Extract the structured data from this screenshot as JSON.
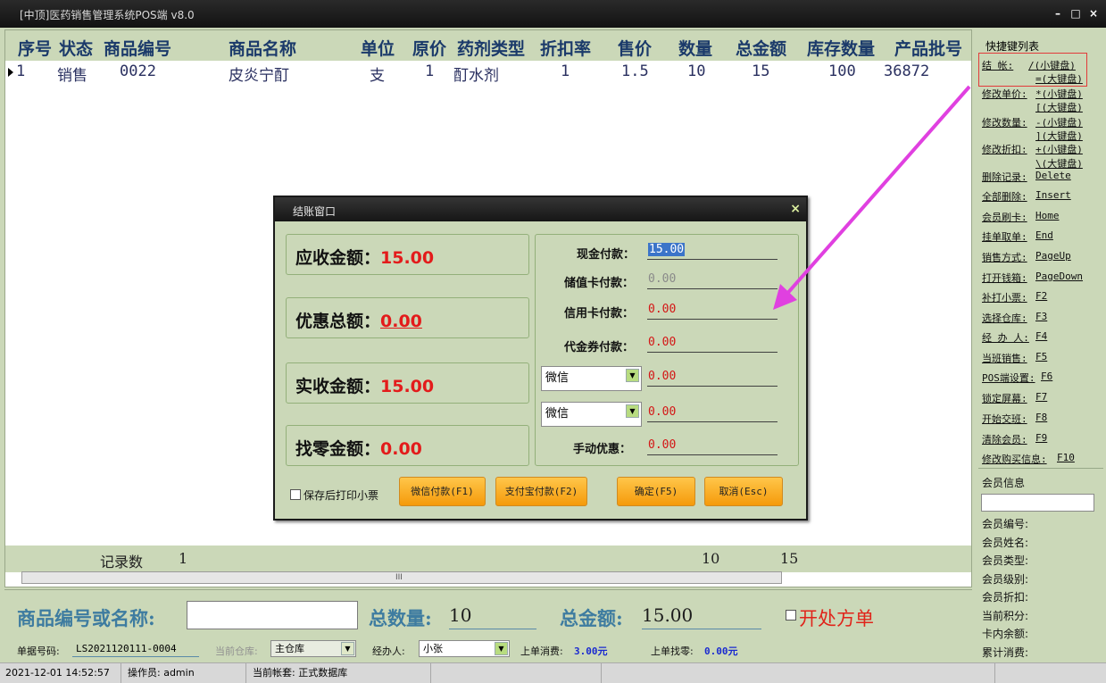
{
  "window": {
    "title": "[中顶]医药销售管理系统POS端 v8.0",
    "buttons": [
      "–",
      "□",
      "×"
    ]
  },
  "grid": {
    "columns": [
      "序号",
      "状态",
      "商品编号",
      "商品名称",
      "单位",
      "原价",
      "药剂类型",
      "折扣率",
      "售价",
      "数量",
      "总金额",
      "库存数量",
      "产品批号"
    ],
    "rows": [
      [
        "1",
        "销售",
        "0022",
        "皮炎宁酊",
        "支",
        "1",
        "酊水剂",
        "1",
        "1.5",
        "10",
        "15",
        "100",
        "36872"
      ]
    ],
    "footer": {
      "count_label": "记录数",
      "count_value": "1",
      "qty_total": "10",
      "amount_total": "15"
    },
    "scroll_grip": "III"
  },
  "sidebar": {
    "title": "快捷键列表",
    "shortcuts": [
      {
        "label": "结 帐:",
        "keys": [
          "/(小键盘)",
          "=(大键盘)"
        ]
      },
      {
        "label": "修改单价:",
        "keys": [
          "*(小键盘)",
          "[(大键盘)"
        ]
      },
      {
        "label": "修改数量:",
        "keys": [
          "-(小键盘)",
          "](大键盘)"
        ]
      },
      {
        "label": "修改折扣:",
        "keys": [
          "+(小键盘)",
          "\\(大键盘)"
        ]
      },
      {
        "label": "删除记录:",
        "keys": [
          "Delete"
        ]
      },
      {
        "label": "全部删除:",
        "keys": [
          "Insert"
        ]
      },
      {
        "label": "会员刷卡:",
        "keys": [
          "Home"
        ]
      },
      {
        "label": "挂单取单:",
        "keys": [
          "End"
        ]
      },
      {
        "label": "销售方式:",
        "keys": [
          "PageUp"
        ]
      },
      {
        "label": "打开钱箱:",
        "keys": [
          "PageDown"
        ]
      },
      {
        "label": "补打小票:",
        "keys": [
          "F2"
        ]
      },
      {
        "label": "选择仓库:",
        "keys": [
          "F3"
        ]
      },
      {
        "label": "经 办 人:",
        "keys": [
          "F4"
        ]
      },
      {
        "label": "当班销售:",
        "keys": [
          "F5"
        ]
      },
      {
        "label": "POS端设置:",
        "keys": [
          "F6"
        ]
      },
      {
        "label": "锁定屏幕:",
        "keys": [
          "F7"
        ]
      },
      {
        "label": "开始交班:",
        "keys": [
          "F8"
        ]
      },
      {
        "label": "清除会员:",
        "keys": [
          "F9"
        ]
      },
      {
        "label": "修改购买信息:",
        "keys": [
          "F10"
        ]
      }
    ],
    "member_title": "会员信息",
    "member_fields": [
      "会员编号:",
      "会员姓名:",
      "会员类型:",
      "会员级别:",
      "会员折扣:",
      "当前积分:",
      "卡内余额:",
      "累计消费:"
    ]
  },
  "bottom": {
    "search_label": "商品编号或名称:",
    "search_value": "",
    "qty_label": "总数量:",
    "qty_value": "10",
    "amount_label": "总金额:",
    "amount_value": "15.00",
    "prescription_label": "开处方单"
  },
  "info": {
    "order_label": "单据号码:",
    "order_value": "LS2021120111-0004",
    "warehouse_label": "当前仓库:",
    "warehouse_value": "主仓库",
    "handler_label": "经办人:",
    "handler_value": "小张",
    "last_spend_label": "上单消费:",
    "last_spend_value": "3.00元",
    "last_change_label": "上单找零:",
    "last_change_value": "0.00元"
  },
  "status": {
    "datetime": "2021-12-01 14:52:57",
    "operator": "操作员: admin",
    "account": "当前帐套: 正式数据库"
  },
  "dialog": {
    "title": "结账窗口",
    "close": "×",
    "receivable_label": "应收金额：",
    "receivable_value": "15.00",
    "discount_label": "优惠总额：",
    "discount_value": "0.00",
    "received_label": "实收金额：",
    "received_value": "15.00",
    "change_label": "找零金额：",
    "change_value": "0.00",
    "cash_label": "现金付款：",
    "cash_value": "15.00",
    "stored_card_label": "储值卡付款：",
    "stored_card_value": "0.00",
    "credit_card_label": "信用卡付款：",
    "credit_card_value": "0.00",
    "voucher_label": "代金券付款：",
    "voucher_value": "0.00",
    "pay_method_1": "微信",
    "pay_method_1_value": "0.00",
    "pay_method_2": "微信",
    "pay_method_2_value": "0.00",
    "manual_discount_label": "手动优惠：",
    "manual_discount_value": "0.00",
    "print_label": "保存后打印小票",
    "wechat_btn": "微信付款(F1)",
    "alipay_btn": "支付宝付款(F2)",
    "ok_btn": "确定(F5)",
    "cancel_btn": "取消(Esc)"
  },
  "colors": {
    "panel": "#cbd8b8",
    "header_text": "#1b3a6a",
    "amount_red": "#e31b1b",
    "annotation_arrow": "#e040e0",
    "button_orange": "#f5a623"
  }
}
